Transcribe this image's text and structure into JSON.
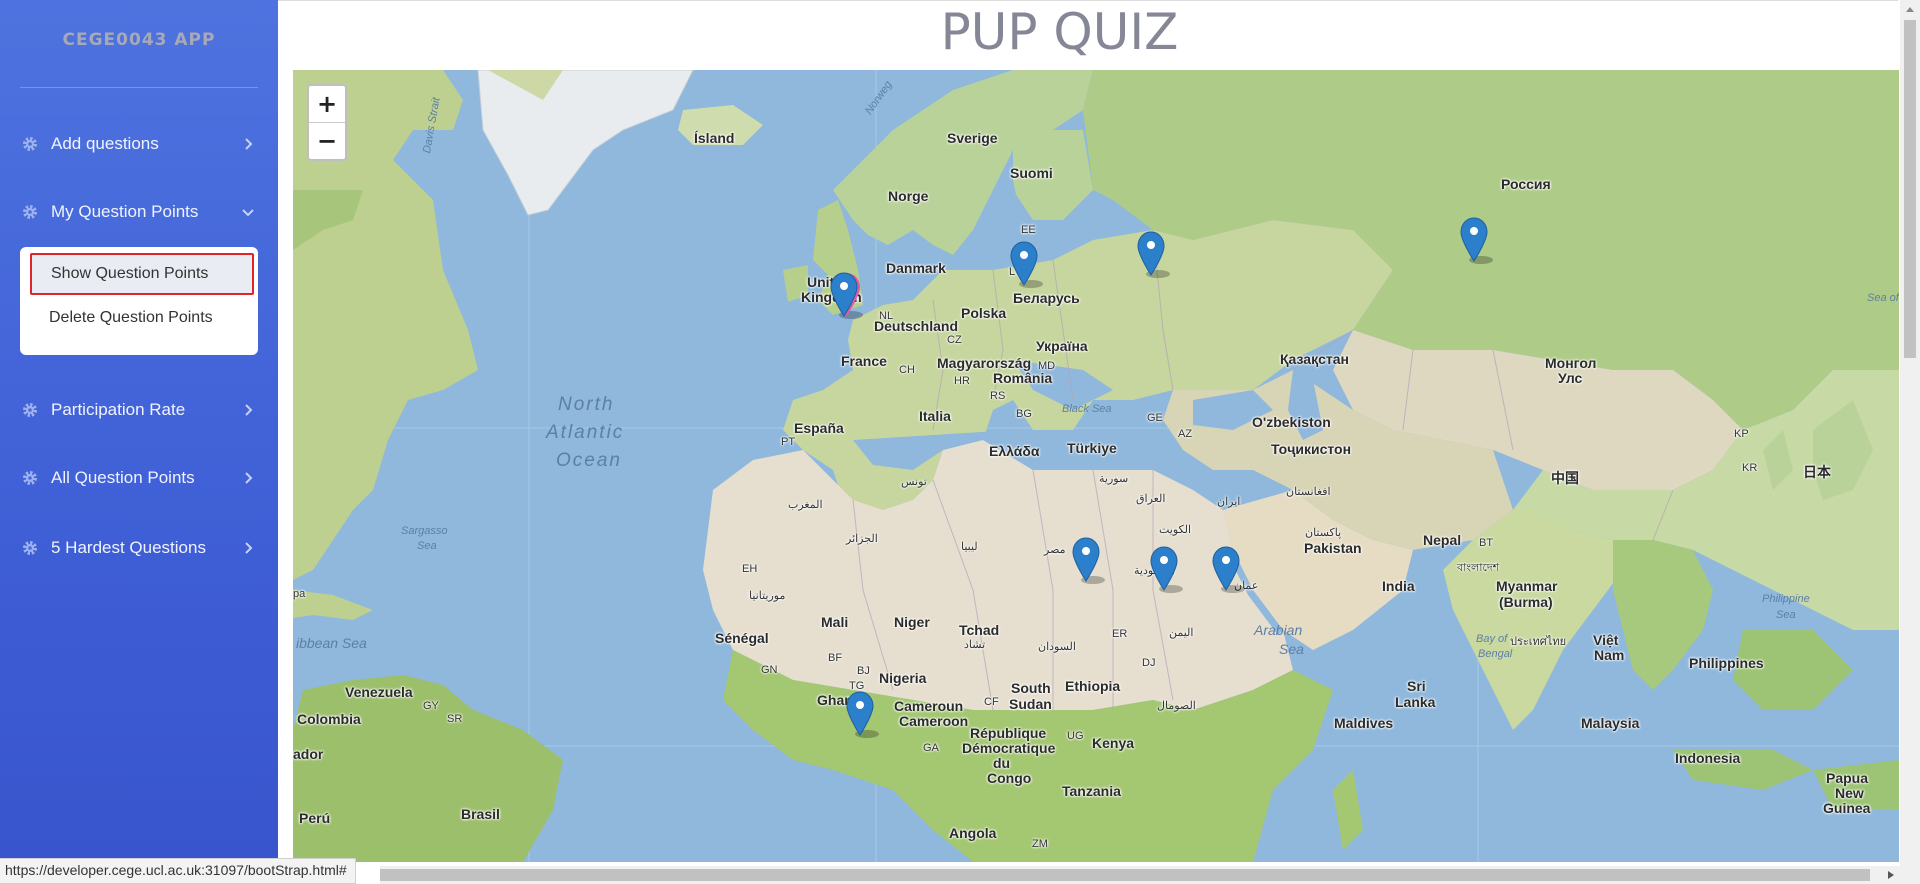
{
  "sidebar": {
    "brand": "CEGE0043 APP",
    "items": [
      {
        "label": "Add questions",
        "icon": "gear-icon",
        "arrow": "chevron-right-icon"
      },
      {
        "label": "My Question Points",
        "icon": "gear-icon",
        "arrow": "chevron-down-icon"
      },
      {
        "label": "Participation Rate",
        "icon": "gear-icon",
        "arrow": "chevron-right-icon"
      },
      {
        "label": "All Question Points",
        "icon": "gear-icon",
        "arrow": "chevron-right-icon"
      },
      {
        "label": "5 Hardest Questions",
        "icon": "gear-icon",
        "arrow": "chevron-right-icon"
      }
    ],
    "submenu": {
      "show_label": "Show Question Points",
      "delete_label": "Delete Question Points"
    }
  },
  "header": {
    "title": "PUP QUIZ"
  },
  "map": {
    "zoom_in": "+",
    "zoom_out": "−",
    "labels": {
      "island": "Ísland",
      "sverige": "Sverige",
      "suomi": "Suomi",
      "norge": "Norge",
      "rossiya": "Россия",
      "danmark": "Danmark",
      "ee": "EE",
      "lv": "LV",
      "belarus": "Беларусь",
      "uk1": "United",
      "uk2": "Kingdom",
      "nl": "NL",
      "deutschland": "Deutschland",
      "polska": "Polska",
      "cz": "CZ",
      "ukraina": "Україна",
      "france": "France",
      "ch": "CH",
      "magyarorszag": "Magyarország",
      "md": "MD",
      "romania": "România",
      "hr": "HR",
      "rs": "RS",
      "bg": "BG",
      "kazakhstan": "Қазақстан",
      "mongol1": "Монгол",
      "mongol2": "Улс",
      "espana": "España",
      "pt": "PT",
      "italia": "Italia",
      "black_sea": "Black Sea",
      "ge": "GE",
      "az": "AZ",
      "uzbekiston": "O'zbekiston",
      "tojikiston": "Тоҷикистон",
      "kp": "KP",
      "kr": "KR",
      "nihon": "日本",
      "turkiye": "Türkiye",
      "ellada": "Ελλάδα",
      "zhongguo": "中国",
      "tunis": "تونس",
      "maghrib": "المغرب",
      "suriya": "سورية",
      "iraq": "العراق",
      "iran": "ایران",
      "afghanistan": "افغانستان",
      "aljazair": "الجزائر",
      "libya": "ليبيا",
      "misr": "مصر",
      "kuwait": "الكويت",
      "pakistan_ar": "پاکستان",
      "pakistan": "Pakistan",
      "nepal": "Nepal",
      "bt": "BT",
      "bangladesh": "বাংলাদেশ",
      "eh": "EH",
      "mauritania": "موريتانيا",
      "saudi": "السعودية",
      "oman": "عمان",
      "india": "India",
      "myanmar1": "Myanmar",
      "myanmar2": "(Burma)",
      "mali": "Mali",
      "niger": "Niger",
      "tchad1": "Tchad",
      "tchad2": "تشاد",
      "sudan": "السودان",
      "er": "ER",
      "yemen": "اليمن",
      "arabian_sea1": "Arabian",
      "arabian_sea2": "Sea",
      "thailand": "ประเทศไทย",
      "vietnam1": "Việt",
      "vietnam2": "Nam",
      "philippines": "Philippines",
      "philippine_sea1": "Philippine",
      "philippine_sea2": "Sea",
      "senegal": "Sénégal",
      "gn": "GN",
      "bf": "BF",
      "bj": "BJ",
      "tg": "TG",
      "nigeria": "Nigeria",
      "ghana": "Ghana",
      "dj": "DJ",
      "ethiopia": "Ethiopia",
      "south_sudan1": "South",
      "south_sudan2": "Sudan",
      "somalia": "الصومال",
      "sri_lanka1": "Sri",
      "sri_lanka2": "Lanka",
      "bay_bengal1": "Bay of",
      "bay_bengal2": "Bengal",
      "cameroun1": "Cameroun",
      "cameroun2": "Cameroon",
      "cf": "CF",
      "ga": "GA",
      "rdc1": "République",
      "rdc2": "Démocratique",
      "rdc3": "du",
      "rdc4": "Congo",
      "ug": "UG",
      "kenya": "Kenya",
      "tanzania": "Tanzania",
      "maldives": "Maldives",
      "malaysia": "Malaysia",
      "indonesia": "Indonesia",
      "png1": "Papua",
      "png2": "New",
      "png3": "Guinea",
      "angola": "Angola",
      "zm": "ZM",
      "venezuela": "Venezuela",
      "gy": "GY",
      "sr": "SR",
      "colombia": "Colombia",
      "ecuador": "ador",
      "peru": "Perú",
      "brasil": "Brasil",
      "caribbean": "ibbean Sea",
      "sargasso1": "Sargasso",
      "sargasso2": "Sea",
      "north": "North",
      "atlantic": "Atlantic",
      "ocean": "Ocean",
      "davis": "Davis Strait",
      "norwegian": "Norweg",
      "sea_of": "Sea of",
      "pa": "pa"
    }
  },
  "status_bar": {
    "url": "https://developer.cege.ucl.ac.uk:31097/bootStrap.html#"
  }
}
